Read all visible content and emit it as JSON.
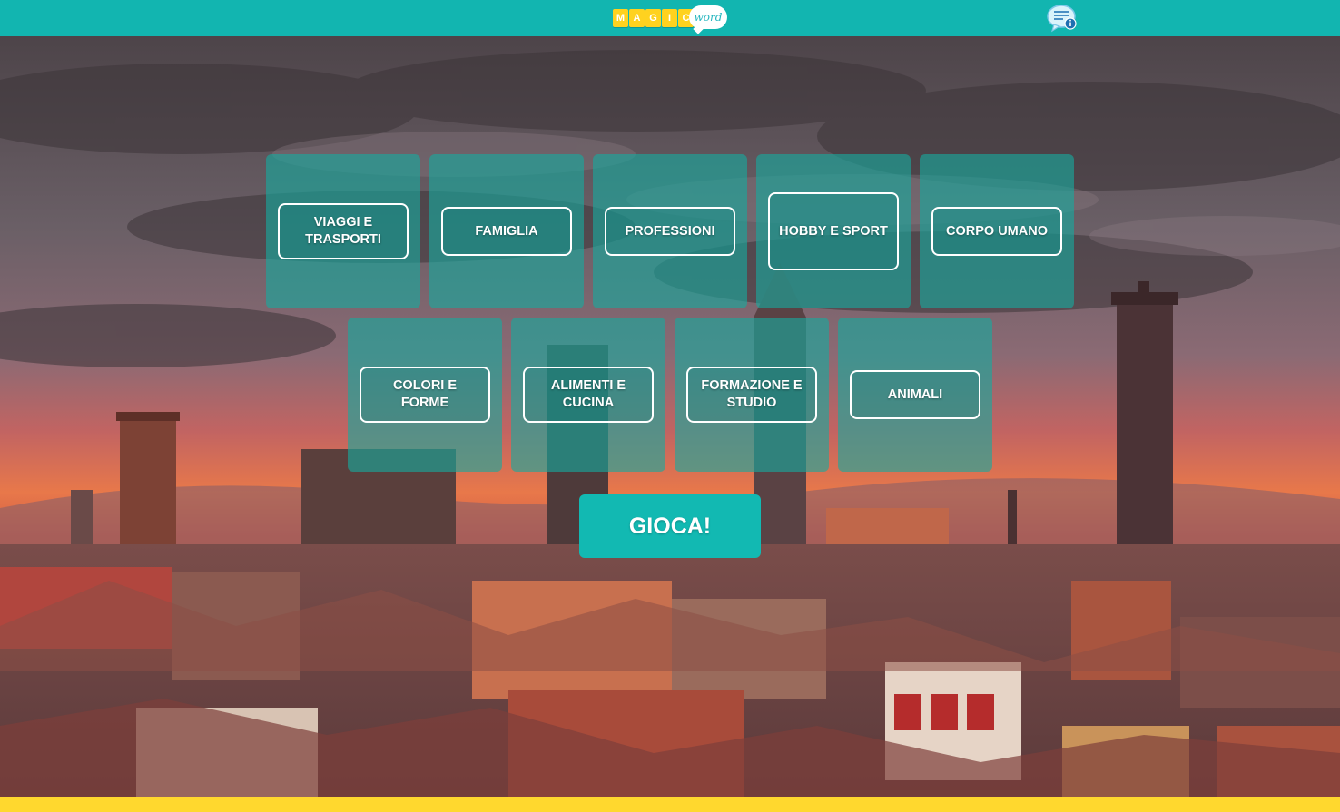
{
  "header": {
    "logo_letters": [
      "M",
      "A",
      "G",
      "I",
      "C"
    ],
    "logo_word": "word",
    "info_icon": "chat-info-icon"
  },
  "categories": [
    {
      "label": "VIAGGI E TRASPORTI"
    },
    {
      "label": "FAMIGLIA"
    },
    {
      "label": "PROFESSIONI"
    },
    {
      "label": "HOBBY E SPORT"
    },
    {
      "label": "CORPO UMANO"
    },
    {
      "label": "COLORI E FORME"
    },
    {
      "label": "ALIMENTI E CUCINA"
    },
    {
      "label": "FORMAZIONE E STUDIO"
    },
    {
      "label": "ANIMALI"
    }
  ],
  "play_label": "GIOCA!",
  "colors": {
    "header": "#12b5b0",
    "accent": "#12b9b2",
    "footer": "#ffd82e",
    "logo_tiles": "#ffd21f"
  }
}
